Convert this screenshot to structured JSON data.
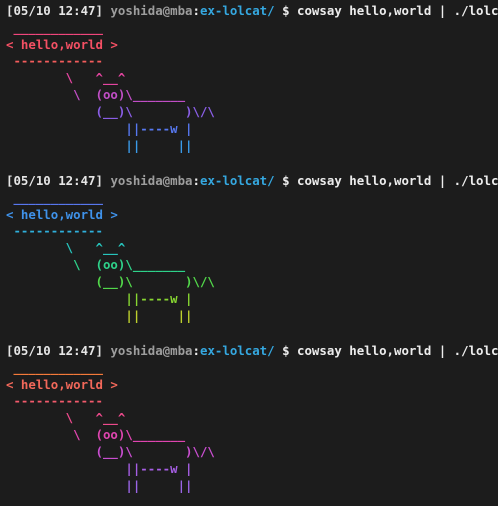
{
  "terminal": {
    "blocks": [
      {
        "prompt": {
          "timestamp": "[05/10 12:47]",
          "user": "yoshida",
          "at": "@",
          "host": "mba",
          "colon": ":",
          "path": "ex-lolcat/",
          "symbol": "$",
          "command": "cowsay hello,world | ./lolcat"
        },
        "lines": [
          {
            "text": " ____________",
            "color": "#f0467c"
          },
          {
            "text": "< hello,world >",
            "color": "#f55064"
          },
          {
            "text": " ------------",
            "color": "#f45c5c"
          },
          {
            "text": "        \\   ^__^",
            "color": "#e445a0"
          },
          {
            "text": "         \\  (oo)\\_______",
            "color": "#c14ec6"
          },
          {
            "text": "            (__)\\       )\\/\\",
            "color": "#8a5ee6"
          },
          {
            "text": "                ||----w |",
            "color": "#5778f0"
          },
          {
            "text": "                ||     ||",
            "color": "#3a9ae8"
          }
        ]
      },
      {
        "prompt": {
          "timestamp": "[05/10 12:47]",
          "user": "yoshida",
          "at": "@",
          "host": "mba",
          "colon": ":",
          "path": "ex-lolcat/",
          "symbol": "$",
          "command": "cowsay hello,world | ./lolcat"
        },
        "lines": [
          {
            "text": " ____________",
            "color": "#5877ee"
          },
          {
            "text": "< hello,world >",
            "color": "#3f92ea"
          },
          {
            "text": " ------------",
            "color": "#2fb0dc"
          },
          {
            "text": "        \\   ^__^",
            "color": "#27c4bc"
          },
          {
            "text": "         \\  (oo)\\_______",
            "color": "#2ed28a"
          },
          {
            "text": "            (__)\\       )\\/\\",
            "color": "#52d84a"
          },
          {
            "text": "                ||----w |",
            "color": "#87d631"
          },
          {
            "text": "                ||     ||",
            "color": "#bccf2d"
          }
        ]
      },
      {
        "prompt": {
          "timestamp": "[05/10 12:47]",
          "user": "yoshida",
          "at": "@",
          "host": "mba",
          "colon": ":",
          "path": "ex-lolcat/",
          "symbol": "$",
          "command": "cowsay hello,world | ./lolcat"
        },
        "lines": [
          {
            "text": " ____________",
            "color": "#f47a3a"
          },
          {
            "text": "< hello,world >",
            "color": "#f2685a"
          },
          {
            "text": " ------------",
            "color": "#f35a6c"
          },
          {
            "text": "        \\   ^__^",
            "color": "#ed4a8c"
          },
          {
            "text": "         \\  (oo)\\_______",
            "color": "#e045b0"
          },
          {
            "text": "            (__)\\       )\\/\\",
            "color": "#c94ed0"
          },
          {
            "text": "                ||----w |",
            "color": "#a65ee4"
          },
          {
            "text": "                ||     ||",
            "color": "#9a65e6"
          }
        ]
      }
    ]
  }
}
